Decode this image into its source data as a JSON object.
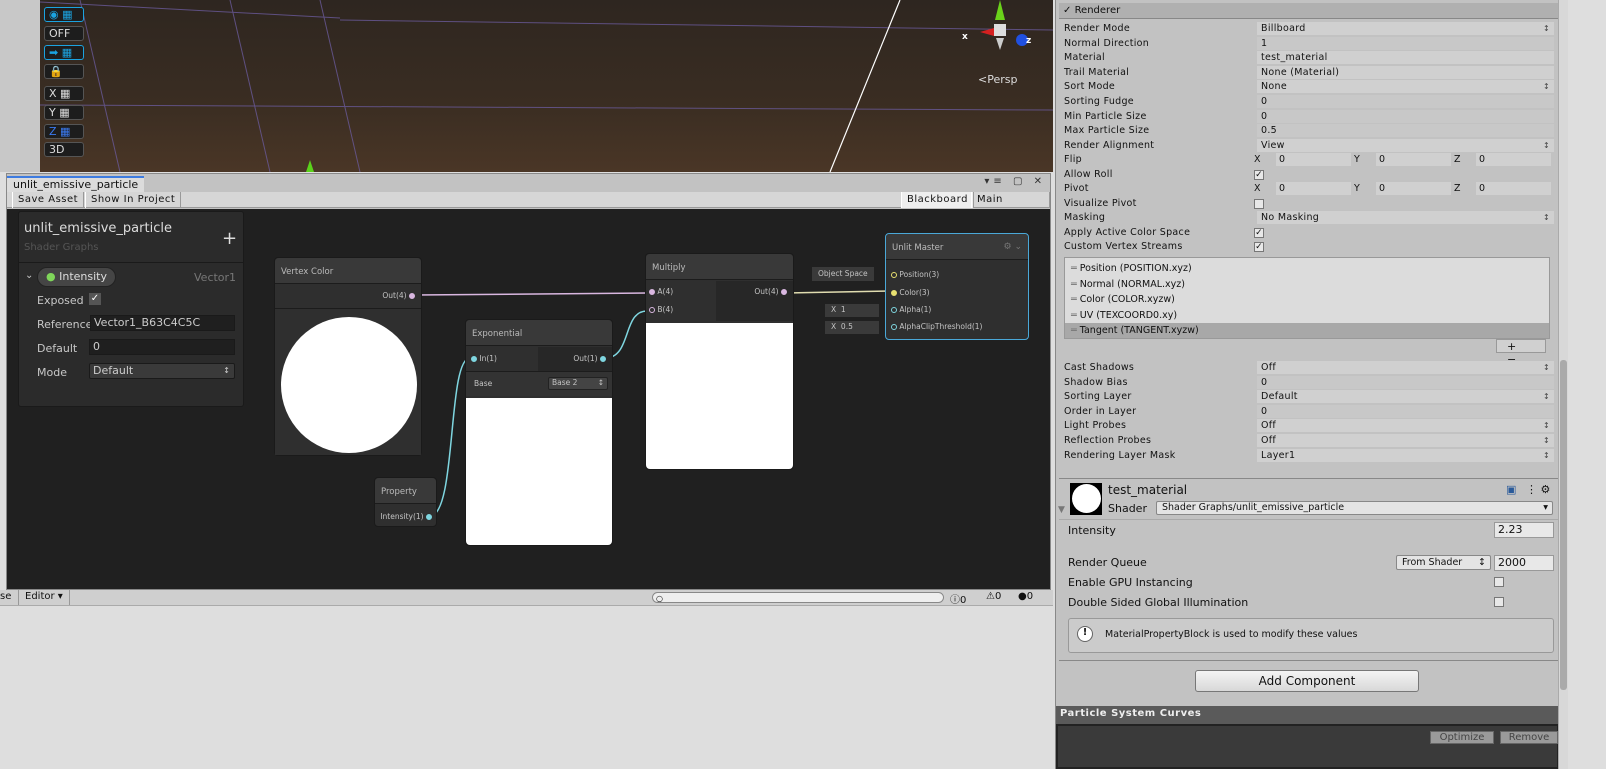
{
  "scene": {
    "tools": [
      "OFF",
      "X",
      "Y",
      "Z",
      "3D"
    ],
    "gizmo_axes": {
      "x": "x",
      "z": "z"
    },
    "projection": "Persp"
  },
  "shader_graph": {
    "tab": "unlit_emissive_particle",
    "toolbar": {
      "save": "Save Asset",
      "show": "Show In Project",
      "blackboard": "Blackboard",
      "preview": "Main Preview"
    },
    "blackboard": {
      "title": "unlit_emissive_particle",
      "subtitle": "Shader Graphs",
      "add": "+",
      "property": {
        "name": "Intensity",
        "type": "Vector1",
        "exposed_label": "Exposed",
        "exposed": true,
        "reference_label": "Reference",
        "reference": "Vector1_B63C4C5C",
        "default_label": "Default",
        "default": "0",
        "mode_label": "Mode",
        "mode": "Default"
      }
    },
    "nodes": {
      "vertex_color": {
        "title": "Vertex Color",
        "out": "Out(4)"
      },
      "exponential": {
        "title": "Exponential",
        "in": "In(1)",
        "out": "Out(1)",
        "base_label": "Base",
        "base": "Base 2"
      },
      "multiply": {
        "title": "Multiply",
        "a": "A(4)",
        "b": "B(4)",
        "out": "Out(4)"
      },
      "property": {
        "title": "Property",
        "out": "Intensity(1)"
      },
      "master": {
        "title": "Unlit Master",
        "ports": [
          "Position(3)",
          "Color(3)",
          "Alpha(1)",
          "AlphaClipThreshold(1)"
        ],
        "position_space": "Object Space",
        "alpha": "1",
        "clip": "0.5",
        "x_label": "X"
      }
    }
  },
  "status": {
    "left": "se",
    "editor": "Editor ▾",
    "counts": [
      "0",
      "0",
      "0"
    ]
  },
  "inspector": {
    "renderer_header": "Renderer",
    "rows": [
      {
        "label": "Render Mode",
        "value": "Billboard",
        "type": "popup"
      },
      {
        "label": "Normal Direction",
        "value": "1",
        "type": "field"
      },
      {
        "label": "Material",
        "value": "test_material",
        "type": "object"
      },
      {
        "label": "Trail Material",
        "value": "None (Material)",
        "type": "object"
      },
      {
        "label": "Sort Mode",
        "value": "None",
        "type": "popup"
      },
      {
        "label": "Sorting Fudge",
        "value": "0",
        "type": "field"
      },
      {
        "label": "Min Particle Size",
        "value": "0",
        "type": "field"
      },
      {
        "label": "Max Particle Size",
        "value": "0.5",
        "type": "field"
      },
      {
        "label": "Render Alignment",
        "value": "View",
        "type": "popup"
      }
    ],
    "flip": {
      "label": "Flip",
      "x": "0",
      "y": "0",
      "z": "0"
    },
    "allow_roll": {
      "label": "Allow Roll",
      "checked": true
    },
    "pivot": {
      "label": "Pivot",
      "x": "0",
      "y": "0",
      "z": "0"
    },
    "visualize_pivot": {
      "label": "Visualize Pivot",
      "checked": false
    },
    "masking": {
      "label": "Masking",
      "value": "No Masking"
    },
    "apply_color": {
      "label": "Apply Active Color Space",
      "checked": true
    },
    "custom_streams": {
      "label": "Custom Vertex Streams",
      "checked": true
    },
    "streams": [
      "Position (POSITION.xyz)",
      "Normal (NORMAL.xyz)",
      "Color (COLOR.xyzw)",
      "UV (TEXCOORD0.xy)",
      "Tangent (TANGENT.xyzw)"
    ],
    "rows2": [
      {
        "label": "Cast Shadows",
        "value": "Off",
        "type": "popup"
      },
      {
        "label": "Shadow Bias",
        "value": "0",
        "type": "field"
      },
      {
        "label": "Sorting Layer",
        "value": "Default",
        "type": "popup"
      },
      {
        "label": "Order in Layer",
        "value": "0",
        "type": "field"
      },
      {
        "label": "Light Probes",
        "value": "Off",
        "type": "popup"
      },
      {
        "label": "Reflection Probes",
        "value": "Off",
        "type": "popup"
      },
      {
        "label": "Rendering Layer Mask",
        "value": "Layer1",
        "type": "popup"
      }
    ],
    "material": {
      "name": "test_material",
      "shader_label": "Shader",
      "shader": "Shader Graphs/unlit_emissive_particle",
      "intensity_label": "Intensity",
      "intensity": "2.23",
      "queue_label": "Render Queue",
      "queue_mode": "From Shader",
      "queue": "2000",
      "gpu_label": "Enable GPU Instancing",
      "gpu": false,
      "dsgi_label": "Double Sided Global Illumination",
      "dsgi": false,
      "help": "MaterialPropertyBlock is used to modify these values"
    },
    "add_component": "Add Component",
    "curves": {
      "title": "Particle System Curves",
      "optimize": "Optimize",
      "remove": "Remove"
    }
  }
}
